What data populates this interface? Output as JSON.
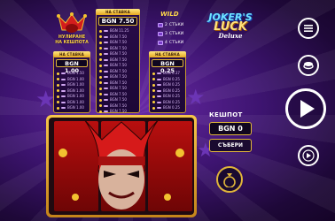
{
  "colors": {
    "gold": "#f2c230",
    "purple_bg": "#3d1470",
    "reel_red": "#b80f0f"
  },
  "top_left": {
    "title_line1": "НУЛИРАНЕ",
    "title_line2": "НА КЕШПОТА",
    "bet_label": "НА СТАВКА",
    "bet_value": "BGN 1.00",
    "rows": [
      "BGN 1.50",
      "BGN 1.00",
      "BGN 1.00",
      "BGN 1.00",
      "BGN 1.00",
      "BGN 1.00",
      "BGN 1.00"
    ]
  },
  "top_center": {
    "bet_label": "НА СТАВКА",
    "bet_value": "BGN 7.50",
    "rows": [
      "BGN 11.25",
      "BGN 7.50",
      "BGN 7.50",
      "BGN 7.50",
      "BGN 7.50",
      "BGN 7.50",
      "BGN 7.50",
      "BGN 7.50",
      "BGN 7.50",
      "BGN 7.50",
      "BGN 7.50",
      "BGN 7.50",
      "BGN 7.50",
      "BGN 7.50",
      "BGN 7.50"
    ]
  },
  "top_right": {
    "bet_label": "НА СТАВКА",
    "bet_value": "BGN 0.25",
    "rows": [
      "BGN 0.37",
      "BGN 0.25",
      "BGN 0.25",
      "BGN 0.25",
      "BGN 0.25",
      "BGN 0.25",
      "BGN 0.25"
    ]
  },
  "wild": {
    "title": "WILD",
    "rows": [
      {
        "count": "2",
        "label": "СТЪКИ"
      },
      {
        "count": "3",
        "label": "СТЪКИ"
      },
      {
        "count": "4",
        "label": "СТЪКИ"
      }
    ]
  },
  "logo": {
    "line1": "JOKER'S",
    "line2": "LUCK",
    "line3": "Deluxe"
  },
  "jackpot": {
    "title": "КЕШПОТ",
    "value": "BGN 0",
    "collect_label": "СЪБЕРИ"
  },
  "icons": {
    "menu": "hamburger-menu-icon",
    "autoplay": "autoplay-icon",
    "spin": "play-icon",
    "quick_spin": "fast-forward-icon",
    "money_bag": "money-bag-icon"
  }
}
